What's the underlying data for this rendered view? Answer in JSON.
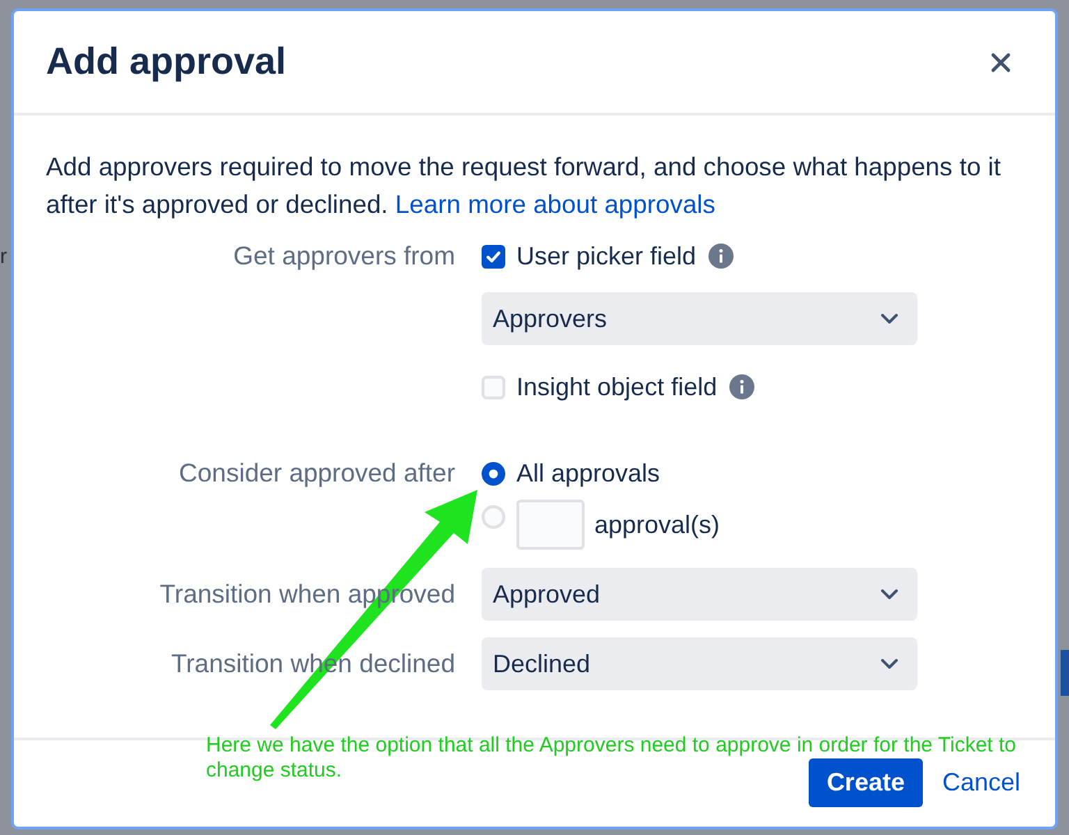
{
  "dialog": {
    "title": "Add approval",
    "description": "Add approvers required to move the request forward, and choose what happens to it after it's approved or declined.",
    "link": "Learn more about approvals"
  },
  "form": [
    {
      "kind": "checkboxes",
      "label": "Get approvers from",
      "items": [
        {
          "kind": "checkbox",
          "label": "User picker field",
          "checked": true
        },
        {
          "kind": "select",
          "value": "Approvers"
        },
        {
          "kind": "checkbox",
          "label": "Insight object field",
          "checked": false
        }
      ]
    },
    {
      "kind": "radios",
      "label": "Consider approved after",
      "options": [
        {
          "kind": "plain",
          "label": "All approvals",
          "selected": true
        },
        {
          "kind": "count",
          "label": "approval(s)",
          "selected": false
        }
      ]
    },
    {
      "kind": "select",
      "label": "Transition when approved",
      "value": "Approved"
    },
    {
      "kind": "select",
      "label": "Transition when declined",
      "value": "Declined"
    }
  ],
  "buttons": [
    {
      "kind": "primary",
      "label": "Create"
    },
    {
      "kind": "link",
      "label": "Cancel"
    }
  ],
  "annotation": {
    "lines": [
      "Here we have the option that all the Approvers need to approve in order for the Ticket to",
      "change status."
    ]
  },
  "background_page": {
    "fragment": "r"
  }
}
